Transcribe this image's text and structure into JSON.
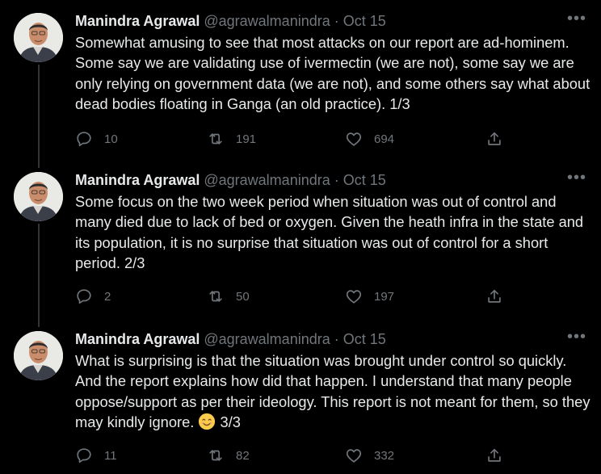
{
  "colors": {
    "background": "#000000",
    "text": "#e7e9ea",
    "muted": "#71767b",
    "thread_line": "#333639"
  },
  "tweets": [
    {
      "name": "Manindra Agrawal",
      "handle": "@agrawalmanindra",
      "separator": "·",
      "date": "Oct 15",
      "more": "•••",
      "text": "Somewhat amusing to see that most attacks on our report are ad-hominem. Some say we are validating use of ivermectin (we are not), some say we are only relying on government data (we are not), and some others say what about dead bodies floating in Ganga (an old practice). 1/3",
      "replies": "10",
      "retweets": "191",
      "likes": "694"
    },
    {
      "name": "Manindra Agrawal",
      "handle": "@agrawalmanindra",
      "separator": "·",
      "date": "Oct 15",
      "more": "•••",
      "text": "Some focus on the two week period when situation was out of control and many died due to lack of bed or oxygen. Given the heath infra in the state and its population, it is no surprise that situation was out of control for a short period. 2/3",
      "replies": "2",
      "retweets": "50",
      "likes": "197"
    },
    {
      "name": "Manindra Agrawal",
      "handle": "@agrawalmanindra",
      "separator": "·",
      "date": "Oct 15",
      "more": "•••",
      "text": "What is surprising is that the situation was brought under control so quickly. And the report explains how did that happen. I understand that many people oppose/support as per their ideology. This report is not meant for them, so they may kindly ignore.",
      "text_suffix": "3/3",
      "replies": "11",
      "retweets": "82",
      "likes": "332"
    }
  ],
  "icons": [
    "reply-icon",
    "retweet-icon",
    "like-icon",
    "share-icon",
    "smiling-emoji-icon"
  ]
}
